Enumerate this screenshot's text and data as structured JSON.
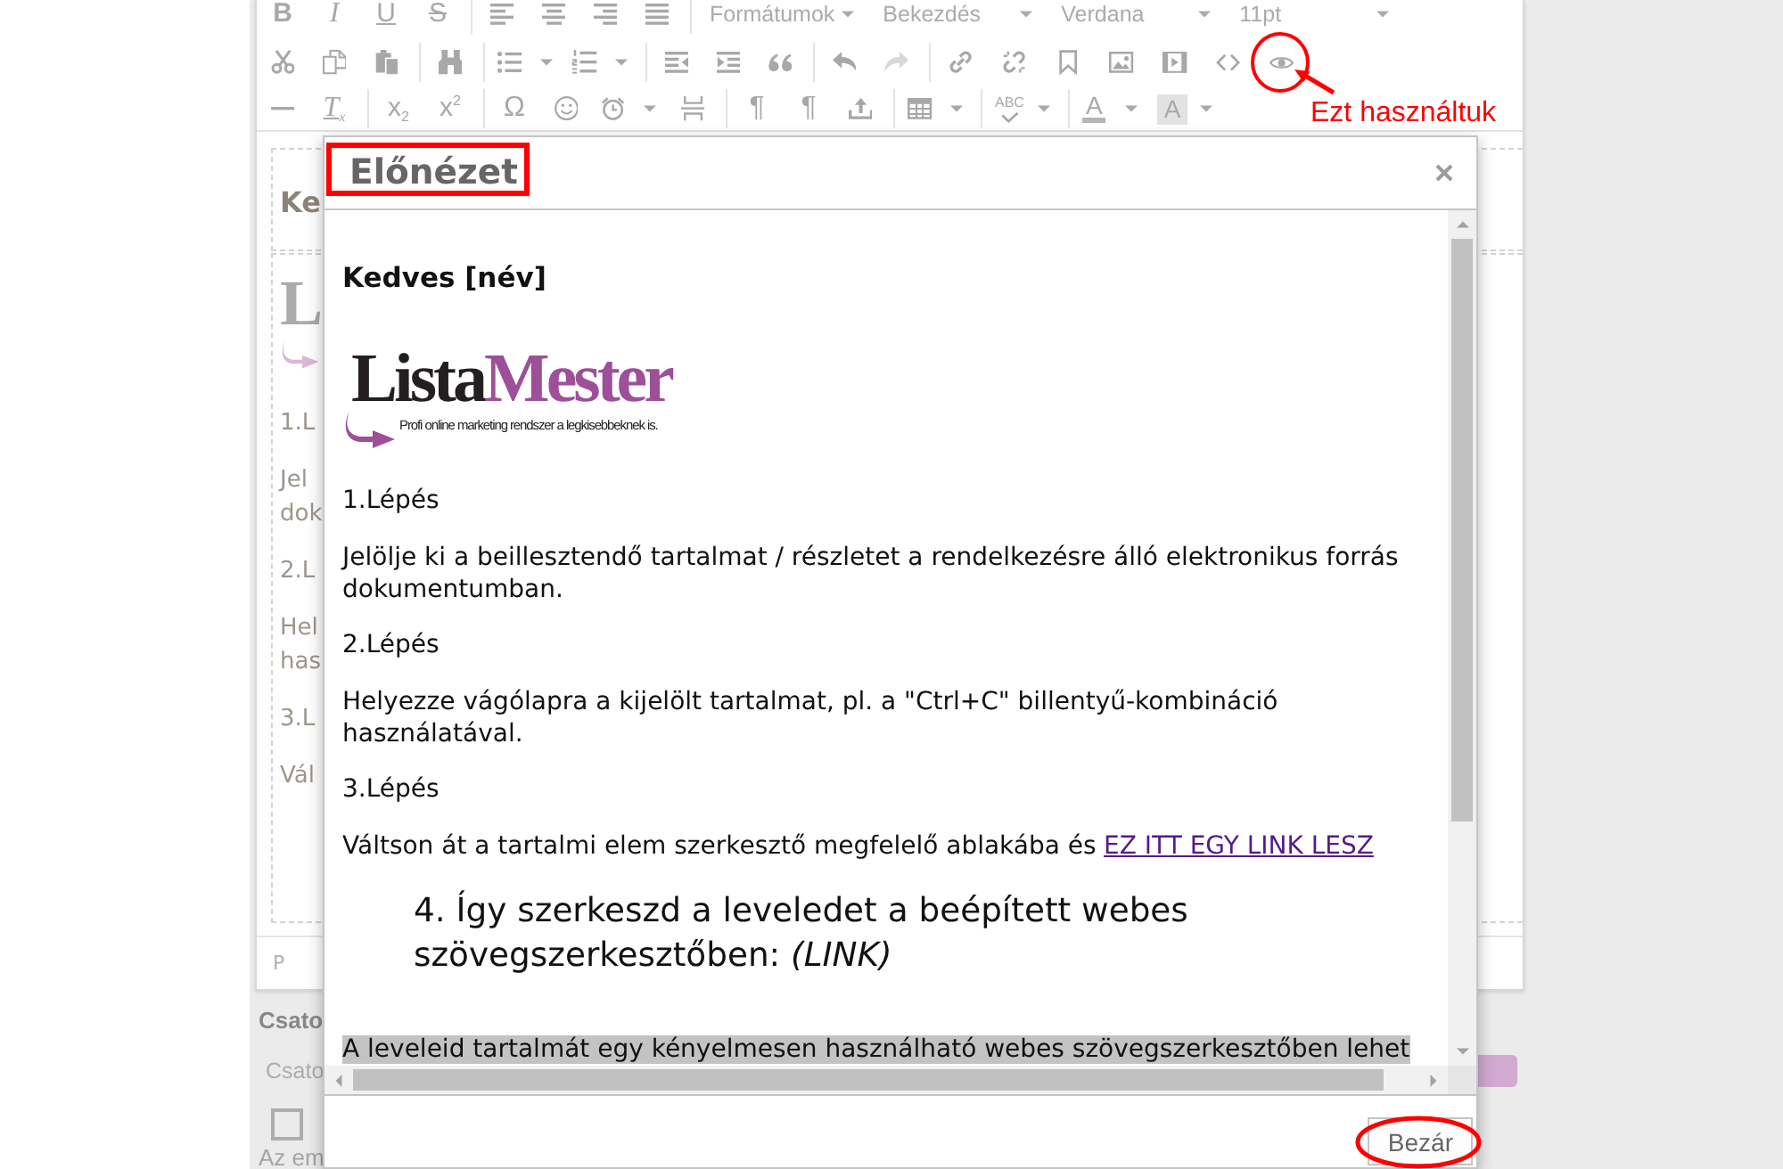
{
  "toolbar": {
    "lines": [
      {
        "groups": [
          {
            "items": [
              {
                "kind": "bold",
                "label": "B",
                "disabled": false
              },
              {
                "kind": "italic",
                "label": "I",
                "disabled": false
              },
              {
                "kind": "underline",
                "label": "U",
                "disabled": false
              },
              {
                "kind": "strike",
                "label": "S",
                "disabled": false
              }
            ]
          },
          {
            "items": [
              {
                "kind": "icon",
                "disabled": false
              },
              {
                "kind": "icon",
                "disabled": false
              },
              {
                "kind": "icon",
                "disabled": false
              },
              {
                "kind": "icon",
                "disabled": false
              }
            ]
          },
          {
            "items": [
              {
                "kind": "menu",
                "label": "Formátumok",
                "caret": true,
                "disabled": false
              },
              {
                "kind": "menu",
                "label": "Bekezdés",
                "caret": true,
                "disabled": false
              },
              {
                "kind": "menu",
                "label": "Verdana",
                "caret": true,
                "disabled": false
              },
              {
                "kind": "menu",
                "label": "11pt",
                "caret": true,
                "disabled": false
              }
            ]
          }
        ]
      },
      {
        "groups": [
          {
            "items": [
              {
                "kind": "icon",
                "disabled": false
              },
              {
                "kind": "icon",
                "disabled": false
              },
              {
                "kind": "icon",
                "disabled": false
              }
            ]
          },
          {
            "items": [
              {
                "kind": "icon",
                "disabled": false
              }
            ]
          },
          {
            "items": [
              {
                "kind": "icon",
                "caret": true,
                "disabled": false
              },
              {
                "kind": "icon",
                "caret": true,
                "disabled": false
              }
            ]
          },
          {
            "items": [
              {
                "kind": "icon",
                "disabled": false
              },
              {
                "kind": "icon",
                "disabled": false
              },
              {
                "kind": "icon",
                "disabled": false
              }
            ]
          },
          {
            "items": [
              {
                "kind": "icon",
                "disabled": false
              },
              {
                "kind": "icon",
                "disabled": true
              }
            ]
          },
          {
            "items": [
              {
                "kind": "icon",
                "disabled": false
              },
              {
                "kind": "icon",
                "disabled": false
              },
              {
                "kind": "icon",
                "disabled": false
              },
              {
                "kind": "icon",
                "disabled": false
              },
              {
                "kind": "icon",
                "disabled": false
              },
              {
                "kind": "icon",
                "disabled": false
              },
              {
                "kind": "icon",
                "disabled": false
              }
            ]
          }
        ]
      },
      {
        "groups": [
          {
            "items": [
              {
                "kind": "icon",
                "disabled": false
              },
              {
                "kind": "clear",
                "label": "T$_{x}$",
                "disabled": false
              }
            ]
          },
          {
            "items": [
              {
                "kind": "sub",
                "label": "x$_{2}$",
                "disabled": false
              },
              {
                "kind": "sup",
                "label": "x$^{2}$",
                "disabled": false
              }
            ]
          },
          {
            "items": [
              {
                "kind": "symbol",
                "label": "Ω",
                "disabled": false
              },
              {
                "kind": "icon",
                "disabled": false
              },
              {
                "kind": "icon",
                "caret": true,
                "disabled": false
              },
              {
                "kind": "icon",
                "disabled": false
              }
            ]
          },
          {
            "items": [
              {
                "kind": "symbol",
                "label": "¶",
                "disabled": false
              },
              {
                "kind": "symbol",
                "label": "¶",
                "disabled": false
              },
              {
                "kind": "icon",
                "disabled": false
              }
            ]
          },
          {
            "items": [
              {
                "kind": "icon",
                "caret": true,
                "disabled": false
              }
            ]
          },
          {
            "items": [
              {
                "kind": "spell",
                "label": "ABC",
                "caret": true,
                "disabled": false
              }
            ]
          },
          {
            "items": [
              {
                "kind": "textcolor",
                "label": "A",
                "caret": true,
                "disabled": false
              },
              {
                "kind": "bgcolor",
                "label": "A",
                "caret": true,
                "disabled": false
              }
            ]
          }
        ]
      }
    ]
  },
  "editor": {
    "cells": [
      [
        {
          "kind": "heading",
          "text": "Ke"
        }
      ],
      [
        {
          "kind": "logo",
          "text": "L"
        },
        {
          "kind": "para",
          "lines": [
            "1.L"
          ]
        },
        {
          "kind": "para",
          "lines": [
            "Jel",
            "dok"
          ]
        },
        {
          "kind": "para",
          "lines": [
            "2.L"
          ]
        },
        {
          "kind": "para",
          "lines": [
            "Hel",
            "has"
          ]
        },
        {
          "kind": "para",
          "lines": [
            "3.L"
          ]
        },
        {
          "kind": "para",
          "lines": [
            "Vál"
          ]
        }
      ]
    ],
    "path": "P"
  },
  "attachments": {
    "title": "Csato",
    "field": {
      "placeholder": "Csato"
    },
    "checkbox": {
      "checked": false
    },
    "note": "Az em"
  },
  "dialog": {
    "title": "Előnézet",
    "preview": {
      "greeting": "Kedves [név]",
      "logo": {
        "name": "Lista",
        "name_accent": "Mester",
        "tagline": "Profi online marketing rendszer a legkisebbeknek is."
      },
      "blocks": [
        {
          "kind": "para",
          "text": "1.Lépés"
        },
        {
          "kind": "para",
          "text": "Jelölje ki a beillesztendő tartalmat / részletet a rendelkezésre álló elektronikus forrás dokumentumban."
        },
        {
          "kind": "para",
          "text": "2.Lépés"
        },
        {
          "kind": "para",
          "text": "Helyezze vágólapra a kijelölt tartalmat, pl. a \"Ctrl+C\" billentyű-kombináció használatával."
        },
        {
          "kind": "para",
          "text": "3.Lépés"
        },
        {
          "kind": "para",
          "text": "Váltson át a tartalmi elem szerkesztő megfelelő ablakába és",
          "link": "EZ ITT EGY LINK LESZ"
        },
        {
          "kind": "heading",
          "text": "4. Így szerkeszd a leveledet a beépített webes szövegszerkesztőben: *(LINK)*"
        },
        {
          "kind": "highlight",
          "text": "A leveleid tartalmát egy kényelmesen használható webes szövegszerkesztőben lehet"
        }
      ]
    },
    "buttons": [
      {
        "label": "Bezár"
      }
    ]
  },
  "annotation": {
    "label": "Ezt használtuk"
  }
}
